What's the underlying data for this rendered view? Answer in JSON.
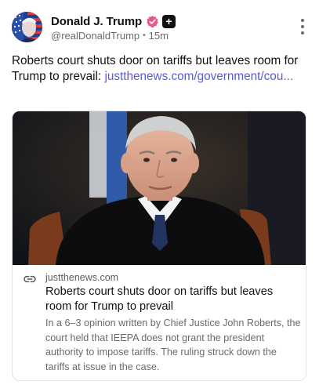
{
  "author": {
    "display_name": "Donald J. Trump",
    "handle": "@realDonaldTrump",
    "separator": "•",
    "time_ago": "15m",
    "plus_badge": "+",
    "verified_color": "#e45a8c",
    "avatar_icon": "american-flag-portrait"
  },
  "post": {
    "text": "Roberts court shuts door on tariffs but leaves room for Trump to prevail: ",
    "link_text": "justthenews.com/government/cou...",
    "link_color": "#5a5ad6"
  },
  "card": {
    "domain": "justthenews.com",
    "title": "Roberts court shuts door on tariffs but leaves room for Trump to prevail",
    "description": "In a 6–3 opinion written by Chief Justice John Roberts, the court held that IEEPA does not grant the president authority to impose tariffs. The ruling struck down the tariffs at issue in the case.",
    "link_icon": "link-icon"
  },
  "menu": {
    "icon": "more-vertical-icon"
  }
}
